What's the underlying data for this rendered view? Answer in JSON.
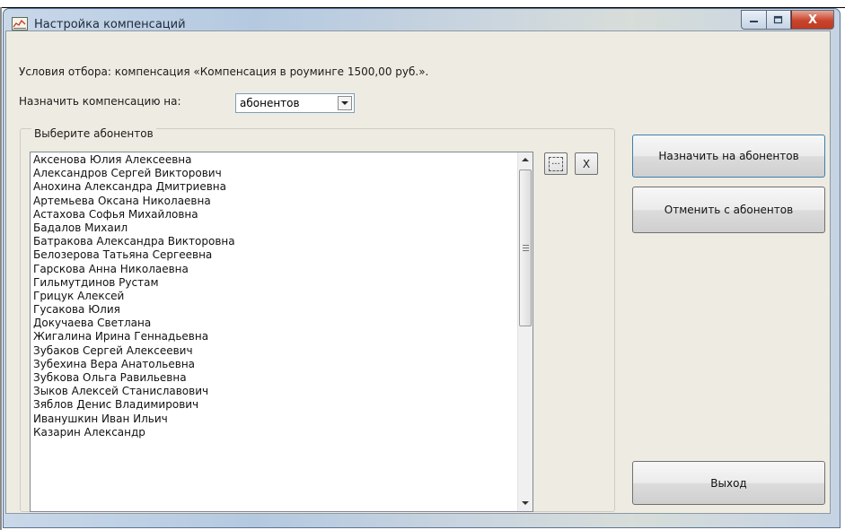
{
  "window": {
    "title": "Настройка компенсаций",
    "caption_min": "—",
    "caption_max": "□",
    "caption_close": "X"
  },
  "filter": {
    "condition_text": "Условия отбора: компенсация «Компенсация в роуминге 1500,00 руб.»."
  },
  "assign_to": {
    "label": "Назначить компенсацию на:",
    "selected": "абонентов"
  },
  "subscribers": {
    "group_title": "Выберите абонентов",
    "items": [
      "Аксенова Юлия Алексеевна",
      "Александров Сергей Викторович",
      "Анохина Александра Дмитриевна",
      "Артемьева Оксана Николаевна",
      "Астахова Софья Михайловна",
      "Бадалов Михаил",
      "Батракова Александра Викторовна",
      "Белозерова Татьяна Сергеевна",
      "Гарскова Анна Николаевна",
      "Гильмутдинов Рустам",
      "Грицук Алексей",
      "Гусакова Юлия",
      "Докучаева Светлана",
      "Жигалина Ирина Геннадьевна",
      "Зубаков Сергей Алексеевич",
      "Зубехина Вера Анатольевна",
      "Зубкова Ольга Равильевна",
      "Зыков Алексей Станиславович",
      "Зяблов Денис Владимирович",
      "Иванушкин Иван Ильич",
      "Казарин Александр"
    ],
    "select_all_glyph": "...",
    "clear_label": "X"
  },
  "buttons": {
    "assign": "Назначить на абонентов",
    "unassign": "Отменить с абонентов",
    "exit": "Выход"
  },
  "colors": {
    "close_button": "#c9442c",
    "dialog_background": "#eeece2"
  }
}
